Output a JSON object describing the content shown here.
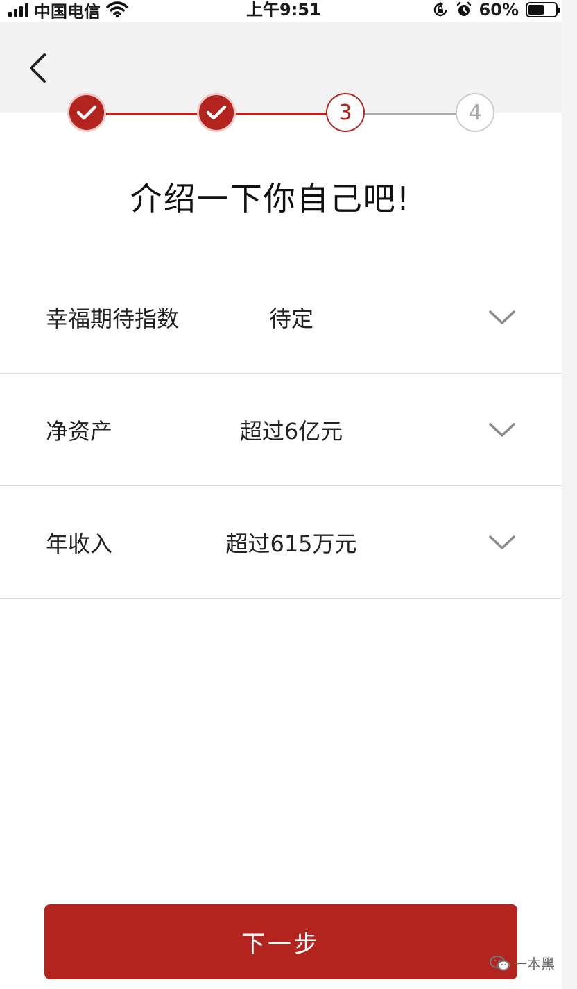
{
  "status_bar": {
    "carrier": "中国电信",
    "time": "上午9:51",
    "battery_percent": "60%",
    "battery_level": 0.6,
    "icons": [
      "signal-icon",
      "wifi-icon",
      "orientation-lock-icon",
      "alarm-icon",
      "battery-icon"
    ]
  },
  "header": {
    "back_icon": "chevron-left-icon"
  },
  "stepper": {
    "current_step": 3,
    "steps": [
      {
        "label": "",
        "state": "done"
      },
      {
        "label": "",
        "state": "done"
      },
      {
        "label": "3",
        "state": "current"
      },
      {
        "label": "4",
        "state": "todo"
      }
    ],
    "colors": {
      "active": "#b3241e",
      "inactive": "#aaaaaa"
    }
  },
  "page_title": "介绍一下你自己吧!",
  "form": {
    "rows": [
      {
        "label": "幸福期待指数",
        "value": "待定"
      },
      {
        "label": "净资产",
        "value": "超过6亿元"
      },
      {
        "label": "年收入",
        "value": "超过615万元"
      }
    ]
  },
  "next_button": {
    "label": "下一步",
    "color": "#b3241e"
  },
  "watermark": {
    "text": "一本黑"
  }
}
